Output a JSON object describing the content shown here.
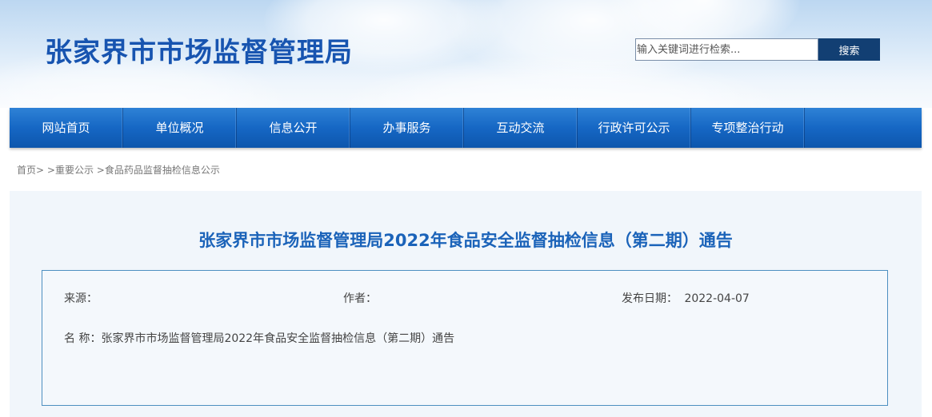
{
  "header": {
    "site_title": "张家界市市场监督管理局",
    "search": {
      "placeholder": "输入关键词进行检索...",
      "button_label": "搜索"
    }
  },
  "nav": {
    "items": [
      {
        "label": "网站首页"
      },
      {
        "label": "单位概况"
      },
      {
        "label": "信息公开"
      },
      {
        "label": "办事服务"
      },
      {
        "label": "互动交流"
      },
      {
        "label": "行政许可公示"
      },
      {
        "label": "专项整治行动"
      }
    ]
  },
  "breadcrumb": {
    "home": "首页>",
    "level1": ">重要公示",
    "level2": ">食品药品监督抽检信息公示"
  },
  "article": {
    "title": "张家界市市场监督管理局2022年食品安全监督抽检信息（第二期）通告",
    "source_label": "来源：",
    "author_label": "作者：",
    "date_label": "发布日期：",
    "date_value": "2022-04-07",
    "name_label": "名 称：",
    "name_value": "张家界市市场监督管理局2022年食品安全监督抽检信息（第二期）通告"
  },
  "colors": {
    "title_blue": "#1754b0",
    "nav_blue": "#1667c4",
    "search_button": "#123f73",
    "article_title": "#1b63b9",
    "box_border": "#4d8fc0"
  }
}
